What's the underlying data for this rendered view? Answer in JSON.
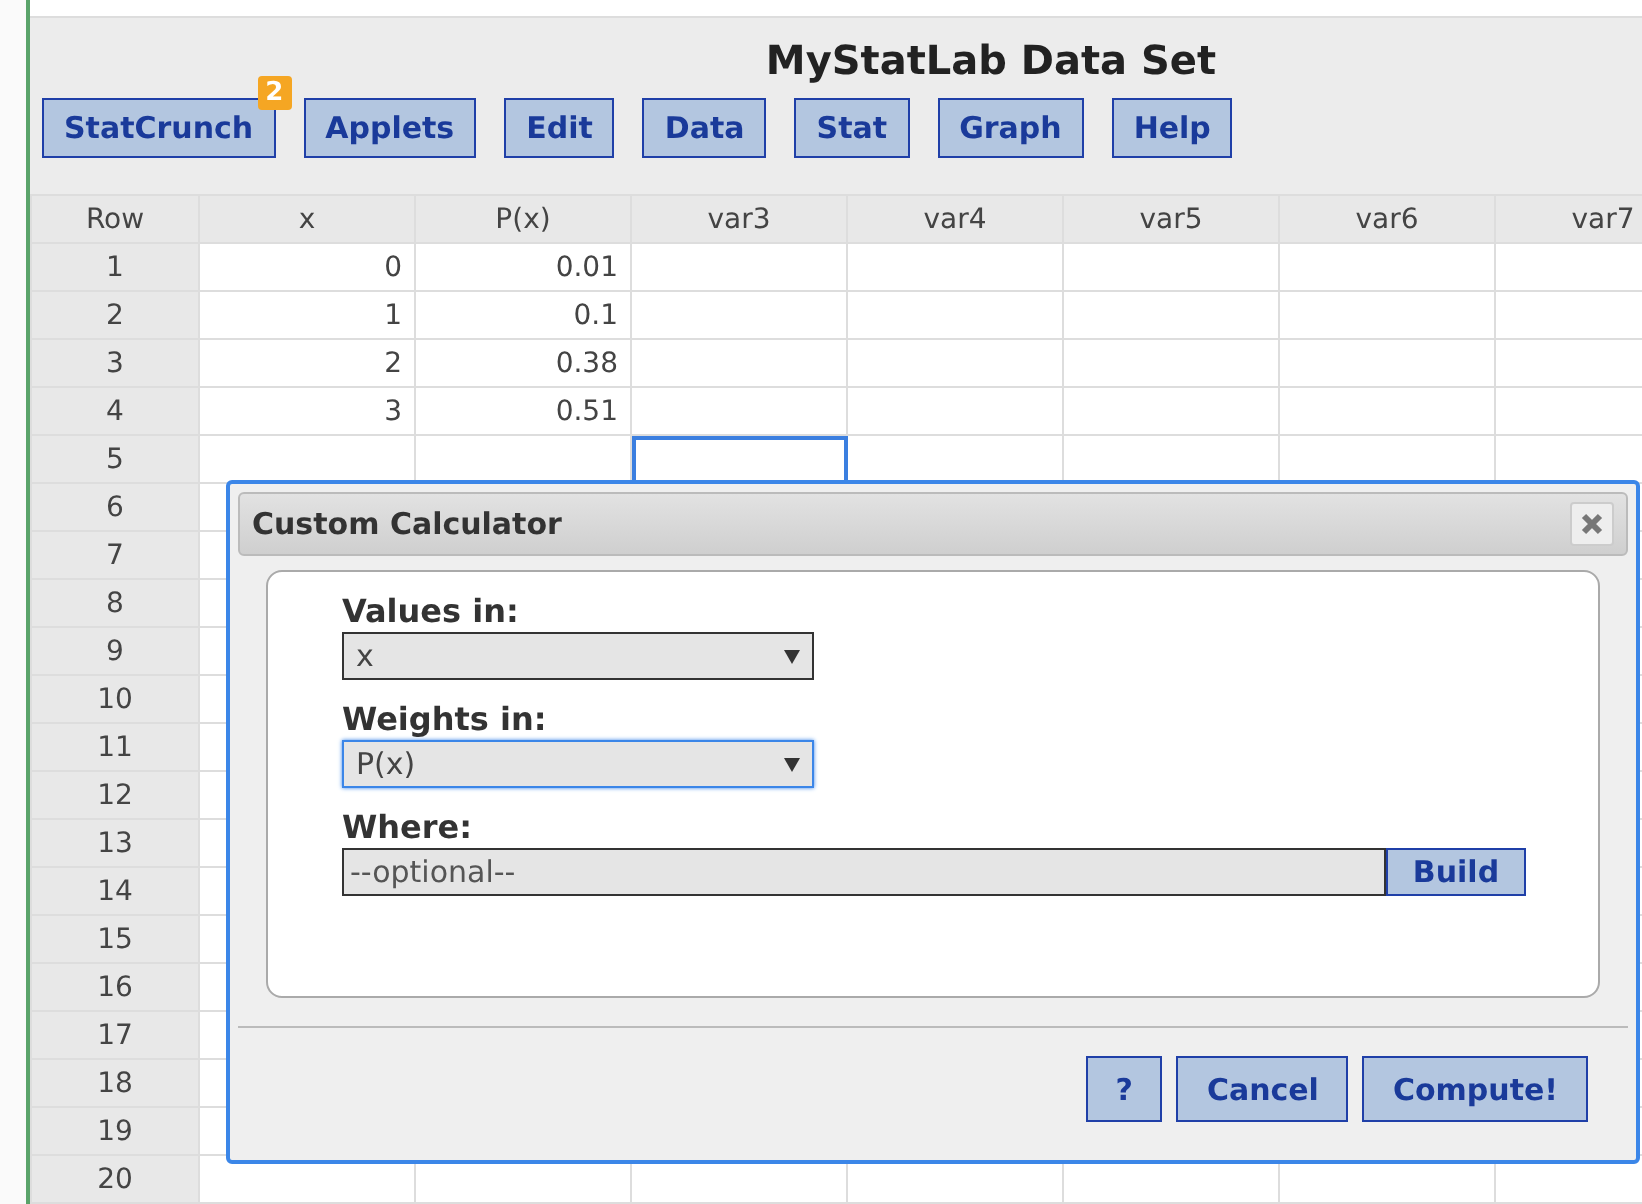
{
  "title": "MyStatLab Data Set",
  "menu": [
    {
      "label": "StatCrunch",
      "badge": "2"
    },
    {
      "label": "Applets"
    },
    {
      "label": "Edit"
    },
    {
      "label": "Data"
    },
    {
      "label": "Stat"
    },
    {
      "label": "Graph"
    },
    {
      "label": "Help"
    }
  ],
  "table": {
    "columns": [
      "Row",
      "x",
      "P(x)",
      "var3",
      "var4",
      "var5",
      "var6",
      "var7"
    ],
    "rows": [
      {
        "row": "1",
        "cells": [
          {
            "text": "0",
            "selected": false
          },
          {
            "text": "0.01",
            "selected": false
          },
          {
            "text": "",
            "selected": false
          }
        ]
      },
      {
        "row": "2",
        "cells": [
          {
            "text": "1",
            "selected": false
          },
          {
            "text": "0.1",
            "selected": false
          },
          {
            "text": "",
            "selected": false
          }
        ]
      },
      {
        "row": "3",
        "cells": [
          {
            "text": "2",
            "selected": false
          },
          {
            "text": "0.38",
            "selected": false
          },
          {
            "text": "",
            "selected": false
          }
        ]
      },
      {
        "row": "4",
        "cells": [
          {
            "text": "3",
            "selected": false
          },
          {
            "text": "0.51",
            "selected": false
          },
          {
            "text": "",
            "selected": false
          }
        ]
      },
      {
        "row": "5",
        "cells": [
          {
            "text": "",
            "selected": false
          },
          {
            "text": "",
            "selected": false
          },
          {
            "text": "",
            "selected": true
          }
        ]
      },
      {
        "row": "6"
      },
      {
        "row": "7"
      },
      {
        "row": "8"
      },
      {
        "row": "9"
      },
      {
        "row": "10"
      },
      {
        "row": "11"
      },
      {
        "row": "12"
      },
      {
        "row": "13"
      },
      {
        "row": "14"
      },
      {
        "row": "15"
      },
      {
        "row": "16"
      },
      {
        "row": "17"
      },
      {
        "row": "18"
      },
      {
        "row": "19"
      },
      {
        "row": "20"
      }
    ]
  },
  "dialog": {
    "title": "Custom Calculator",
    "fields": [
      {
        "kind": "select",
        "label": "Values in:",
        "value": "x",
        "focused": false
      },
      {
        "kind": "select",
        "label": "Weights in:",
        "value": "P(x)",
        "focused": true
      },
      {
        "kind": "input",
        "label": "Where:",
        "placeholder": "--optional--",
        "button": "Build"
      }
    ],
    "buttons": [
      "?",
      "Cancel",
      "Compute!"
    ]
  }
}
